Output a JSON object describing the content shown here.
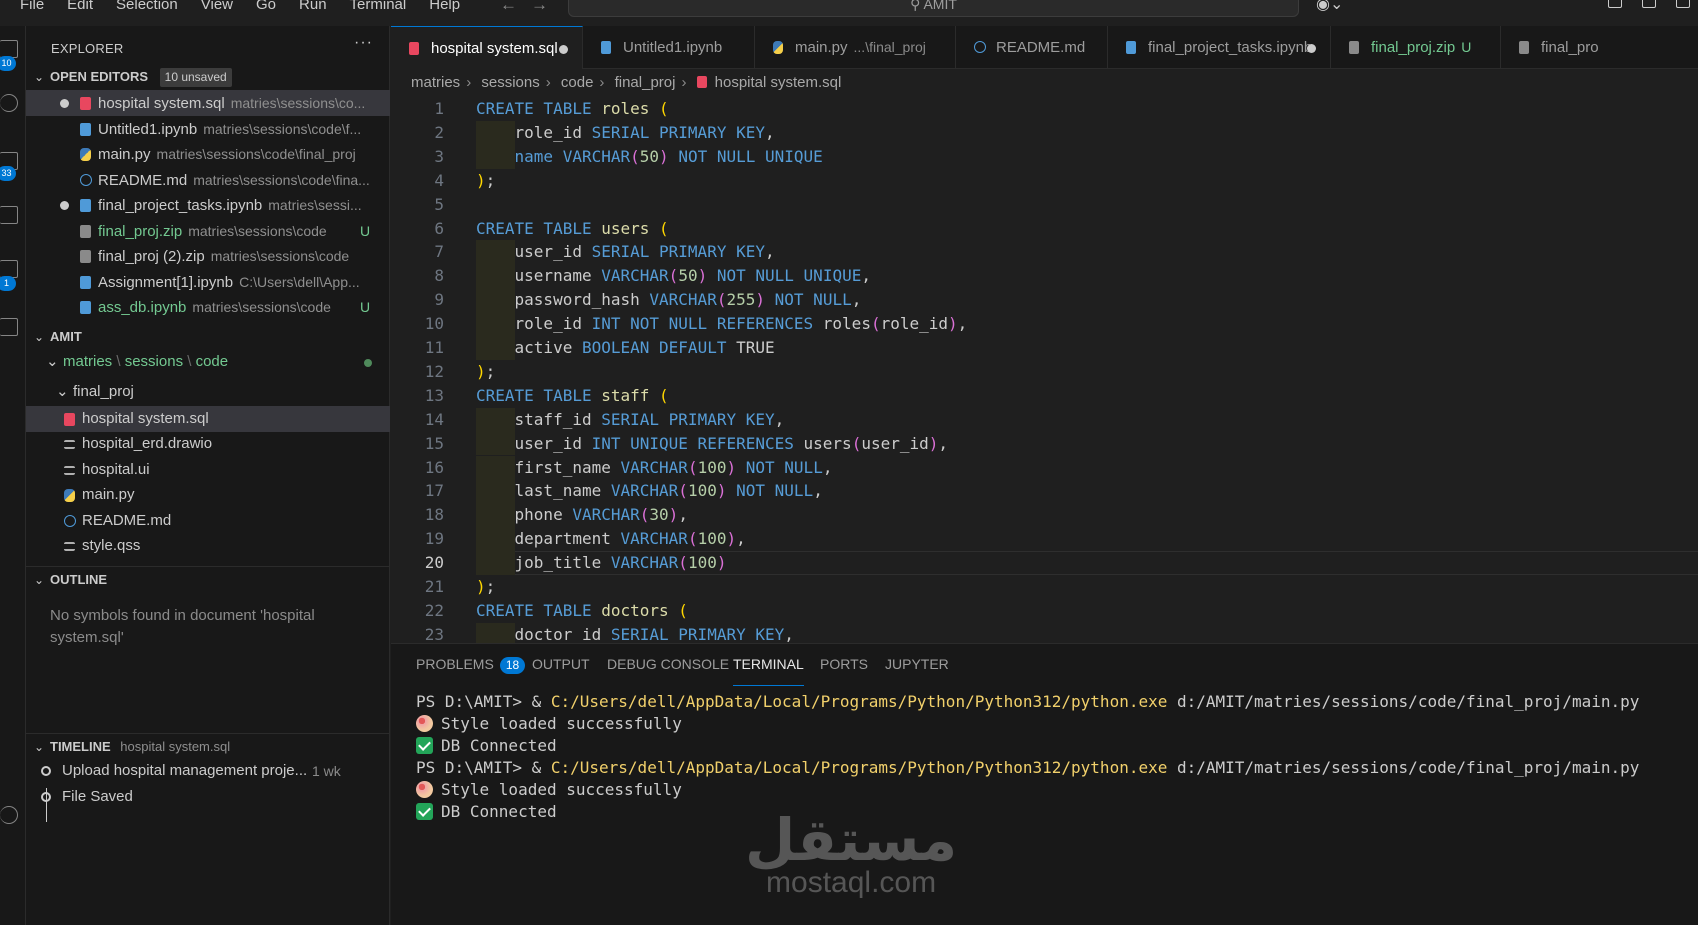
{
  "menu": [
    "File",
    "Edit",
    "Selection",
    "View",
    "Go",
    "Run",
    "Terminal",
    "Help"
  ],
  "search_text": "AMIT",
  "activity_badges": [
    "10",
    "33",
    "1"
  ],
  "explorer": {
    "title": "EXPLORER",
    "open_editors_label": "OPEN EDITORS",
    "unsaved_badge": "10 unsaved",
    "open_editors": [
      {
        "name": "hospital system.sql",
        "path": "matries\\sessions\\co...",
        "dirty": true,
        "icon": "sql-icon"
      },
      {
        "name": "Untitled1.ipynb",
        "path": "matries\\sessions\\code\\f...",
        "dirty": false,
        "icon": "notebook-icon"
      },
      {
        "name": "main.py",
        "path": "matries\\sessions\\code\\final_proj",
        "dirty": false,
        "icon": "python-icon"
      },
      {
        "name": "README.md",
        "path": "matries\\sessions\\code\\fina...",
        "dirty": false,
        "icon": "info-icon"
      },
      {
        "name": "final_project_tasks.ipynb",
        "path": "matries\\sessi...",
        "dirty": true,
        "icon": "notebook-icon"
      },
      {
        "name": "final_proj.zip",
        "path": "matries\\sessions\\code",
        "status": "U",
        "icon": "zip-icon"
      },
      {
        "name": "final_proj (2).zip",
        "path": "matries\\sessions\\code",
        "icon": "zip-icon"
      },
      {
        "name": "Assignment[1].ipynb",
        "path": "C:\\Users\\dell\\App...",
        "icon": "notebook-icon"
      },
      {
        "name": "ass_db.ipynb",
        "path": "matries\\sessions\\code",
        "status": "U",
        "icon": "notebook-icon"
      }
    ],
    "workspace_label": "AMIT",
    "folder_path": [
      "matries",
      "sessions",
      "code"
    ],
    "subfolder": "final_proj",
    "files": [
      {
        "name": "hospital system.sql",
        "icon": "sql-icon"
      },
      {
        "name": "hospital_erd.drawio",
        "icon": "text-icon"
      },
      {
        "name": "hospital.ui",
        "icon": "text-icon"
      },
      {
        "name": "main.py",
        "icon": "python-icon"
      },
      {
        "name": "README.md",
        "icon": "info-icon"
      },
      {
        "name": "style.qss",
        "icon": "text-icon"
      }
    ],
    "outline_label": "OUTLINE",
    "outline_message": "No symbols found in document 'hospital system.sql'",
    "timeline_label": "TIMELINE",
    "timeline_file": "hospital system.sql",
    "timeline": [
      {
        "label": "Upload hospital management proje...",
        "time": "1 wk"
      },
      {
        "label": "File Saved",
        "time": ""
      }
    ]
  },
  "tabs": [
    {
      "label": "hospital system.sql",
      "desc": "",
      "dirty": true,
      "icon": "sql-icon",
      "active": true
    },
    {
      "label": "Untitled1.ipynb",
      "desc": "",
      "icon": "notebook-icon"
    },
    {
      "label": "main.py",
      "desc": "...\\final_proj",
      "icon": "python-icon"
    },
    {
      "label": "README.md",
      "desc": "",
      "icon": "info-icon"
    },
    {
      "label": "final_project_tasks.ipynb",
      "desc": "",
      "dirty": true,
      "icon": "notebook-icon"
    },
    {
      "label": "final_proj.zip",
      "status": "U",
      "icon": "zip-icon"
    },
    {
      "label": "final_pro",
      "icon": "zip-icon"
    }
  ],
  "breadcrumbs": [
    "matries",
    "sessions",
    "code",
    "final_proj",
    "hospital system.sql"
  ],
  "current_line": 20,
  "code": [
    [
      [
        "kw",
        "CREATE TABLE "
      ],
      [
        "tb",
        "roles "
      ],
      [
        "pu",
        "("
      ]
    ],
    [
      [
        "i",
        ""
      ],
      [
        "",
        "role_id "
      ],
      [
        "kw",
        "SERIAL PRIMARY KEY"
      ],
      [
        "",
        ","
      ]
    ],
    [
      [
        "i",
        ""
      ],
      [
        "kw",
        "name "
      ],
      [
        "kw",
        "VARCHAR"
      ],
      [
        "pu2",
        "("
      ],
      [
        "nm",
        "50"
      ],
      [
        "pu2",
        ")"
      ],
      [
        "kw",
        " NOT NULL UNIQUE"
      ]
    ],
    [
      [
        "pu",
        ")"
      ],
      [
        "",
        ";"
      ]
    ],
    [],
    [
      [
        "kw",
        "CREATE TABLE "
      ],
      [
        "tb",
        "users "
      ],
      [
        "pu",
        "("
      ]
    ],
    [
      [
        "i",
        ""
      ],
      [
        "",
        "user_id "
      ],
      [
        "kw",
        "SERIAL PRIMARY KEY"
      ],
      [
        "",
        ","
      ]
    ],
    [
      [
        "i",
        ""
      ],
      [
        "",
        "username "
      ],
      [
        "kw",
        "VARCHAR"
      ],
      [
        "pu2",
        "("
      ],
      [
        "nm",
        "50"
      ],
      [
        "pu2",
        ")"
      ],
      [
        "kw",
        " NOT NULL UNIQUE"
      ],
      [
        "",
        ","
      ]
    ],
    [
      [
        "i",
        ""
      ],
      [
        "",
        "password_hash "
      ],
      [
        "kw",
        "VARCHAR"
      ],
      [
        "pu2",
        "("
      ],
      [
        "nm",
        "255"
      ],
      [
        "pu2",
        ")"
      ],
      [
        "kw",
        " NOT NULL"
      ],
      [
        "",
        ","
      ]
    ],
    [
      [
        "i",
        ""
      ],
      [
        "",
        "role_id "
      ],
      [
        "kw",
        "INT NOT NULL REFERENCES "
      ],
      [
        "",
        "roles"
      ],
      [
        "pu2",
        "("
      ],
      [
        "",
        "role_id"
      ],
      [
        "pu2",
        ")"
      ],
      [
        "",
        ","
      ]
    ],
    [
      [
        "i",
        ""
      ],
      [
        "",
        "active "
      ],
      [
        "kw",
        "BOOLEAN DEFAULT "
      ],
      [
        "",
        "TRUE"
      ]
    ],
    [
      [
        "pu",
        ")"
      ],
      [
        "",
        ";"
      ]
    ],
    [
      [
        "kw",
        "CREATE TABLE "
      ],
      [
        "tb",
        "staff "
      ],
      [
        "pu",
        "("
      ]
    ],
    [
      [
        "i",
        ""
      ],
      [
        "",
        "staff_id "
      ],
      [
        "kw",
        "SERIAL PRIMARY KEY"
      ],
      [
        "",
        ","
      ]
    ],
    [
      [
        "i",
        ""
      ],
      [
        "",
        "user_id "
      ],
      [
        "kw",
        "INT UNIQUE REFERENCES "
      ],
      [
        "",
        "users"
      ],
      [
        "pu2",
        "("
      ],
      [
        "",
        "user_id"
      ],
      [
        "pu2",
        ")"
      ],
      [
        "",
        ","
      ]
    ],
    [
      [
        "i",
        ""
      ],
      [
        "",
        "first_name "
      ],
      [
        "kw",
        "VARCHAR"
      ],
      [
        "pu2",
        "("
      ],
      [
        "nm",
        "100"
      ],
      [
        "pu2",
        ")"
      ],
      [
        "kw",
        " NOT NULL"
      ],
      [
        "",
        ","
      ]
    ],
    [
      [
        "i",
        ""
      ],
      [
        "",
        "last_name "
      ],
      [
        "kw",
        "VARCHAR"
      ],
      [
        "pu2",
        "("
      ],
      [
        "nm",
        "100"
      ],
      [
        "pu2",
        ")"
      ],
      [
        "kw",
        " NOT NULL"
      ],
      [
        "",
        ","
      ]
    ],
    [
      [
        "i",
        ""
      ],
      [
        "",
        "phone "
      ],
      [
        "kw",
        "VARCHAR"
      ],
      [
        "pu2",
        "("
      ],
      [
        "nm",
        "30"
      ],
      [
        "pu2",
        ")"
      ],
      [
        "",
        ","
      ]
    ],
    [
      [
        "i",
        ""
      ],
      [
        "",
        "department "
      ],
      [
        "kw",
        "VARCHAR"
      ],
      [
        "pu2",
        "("
      ],
      [
        "nm",
        "100"
      ],
      [
        "pu2",
        ")"
      ],
      [
        "",
        ","
      ]
    ],
    [
      [
        "i",
        ""
      ],
      [
        "",
        "job_title "
      ],
      [
        "kw",
        "VARCHAR"
      ],
      [
        "pu2",
        "("
      ],
      [
        "nm",
        "100"
      ],
      [
        "pu2",
        ")"
      ]
    ],
    [
      [
        "pu",
        ")"
      ],
      [
        "",
        ";"
      ]
    ],
    [
      [
        "kw",
        "CREATE TABLE "
      ],
      [
        "tb",
        "doctors "
      ],
      [
        "pu",
        "("
      ]
    ],
    [
      [
        "i",
        ""
      ],
      [
        "",
        "doctor_id "
      ],
      [
        "kw",
        "SERIAL PRIMARY KEY"
      ],
      [
        "",
        ","
      ]
    ]
  ],
  "panel": {
    "tabs": [
      {
        "label": "PROBLEMS",
        "badge": "18"
      },
      {
        "label": "OUTPUT"
      },
      {
        "label": "DEBUG CONSOLE"
      },
      {
        "label": "TERMINAL",
        "active": true
      },
      {
        "label": "PORTS"
      },
      {
        "label": "JUPYTER"
      }
    ],
    "terminal": [
      {
        "type": "cmd",
        "prompt": "PS D:\\AMIT> & ",
        "exe": "C:/Users/dell/AppData/Local/Programs/Python/Python312/python.exe",
        "arg": " d:/AMIT/matries/sessions/code/final_proj/main.py"
      },
      {
        "type": "msg",
        "emoji": "palette",
        "text": "Style loaded successfully"
      },
      {
        "type": "msg",
        "emoji": "check",
        "text": "DB Connected"
      },
      {
        "type": "cmd",
        "prompt": "PS D:\\AMIT> & ",
        "exe": "C:/Users/dell/AppData/Local/Programs/Python/Python312/python.exe",
        "arg": " d:/AMIT/matries/sessions/code/final_proj/main.py"
      },
      {
        "type": "msg",
        "emoji": "palette",
        "text": "Style loaded successfully"
      },
      {
        "type": "msg",
        "emoji": "check",
        "text": "DB Connected"
      }
    ]
  },
  "watermark": {
    "arabic": "مستقل",
    "latin": "mostaql.com"
  }
}
